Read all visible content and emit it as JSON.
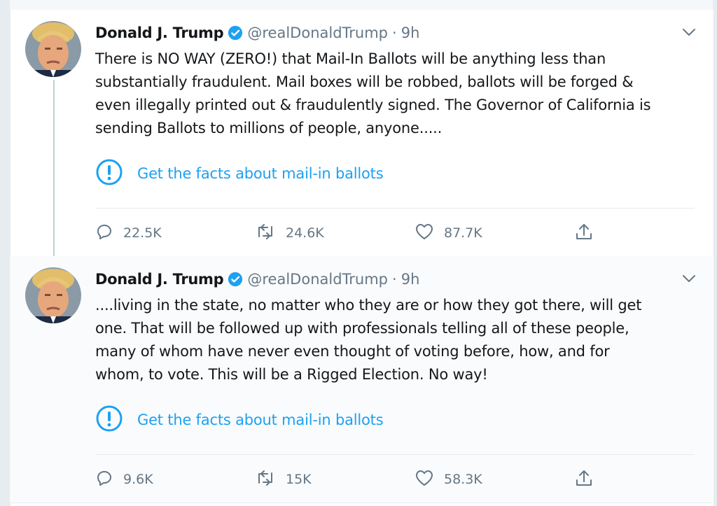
{
  "tweets": [
    {
      "author_name": "Donald J. Trump",
      "handle": "@realDonaldTrump",
      "separator": "·",
      "time": "9h",
      "lines": [
        "There is NO WAY (ZERO!) that Mail-In Ballots will be anything less than",
        "substantially fraudulent. Mail boxes will be robbed, ballots will be forged &",
        "even illegally printed out & fraudulently signed. The Governor of California is",
        "sending Ballots to millions of people, anyone....."
      ],
      "facts_label": "Get the facts about mail-in ballots",
      "replies": "22.5K",
      "retweets": "24.6K",
      "likes": "87.7K"
    },
    {
      "author_name": "Donald J. Trump",
      "handle": "@realDonaldTrump",
      "separator": "·",
      "time": "9h",
      "lines": [
        "....living in the state, no matter who they are or how they got there, will get",
        "one. That will be followed up with professionals telling all of these people,",
        "many of whom have never even thought of voting before, how, and for",
        "whom, to vote. This will be a Rigged Election. No way!"
      ],
      "facts_label": "Get the facts about mail-in ballots",
      "replies": "9.6K",
      "retweets": "15K",
      "likes": "58.3K"
    }
  ],
  "icons": {
    "verified": "verified-badge-icon",
    "caret": "chevron-down-icon",
    "facts": "exclamation-circle-icon",
    "reply": "comment-icon",
    "retweet": "retweet-icon",
    "like": "heart-icon",
    "share": "share-icon"
  },
  "colors": {
    "accent": "#1da1f2",
    "muted": "#657786",
    "text": "#14171a"
  }
}
